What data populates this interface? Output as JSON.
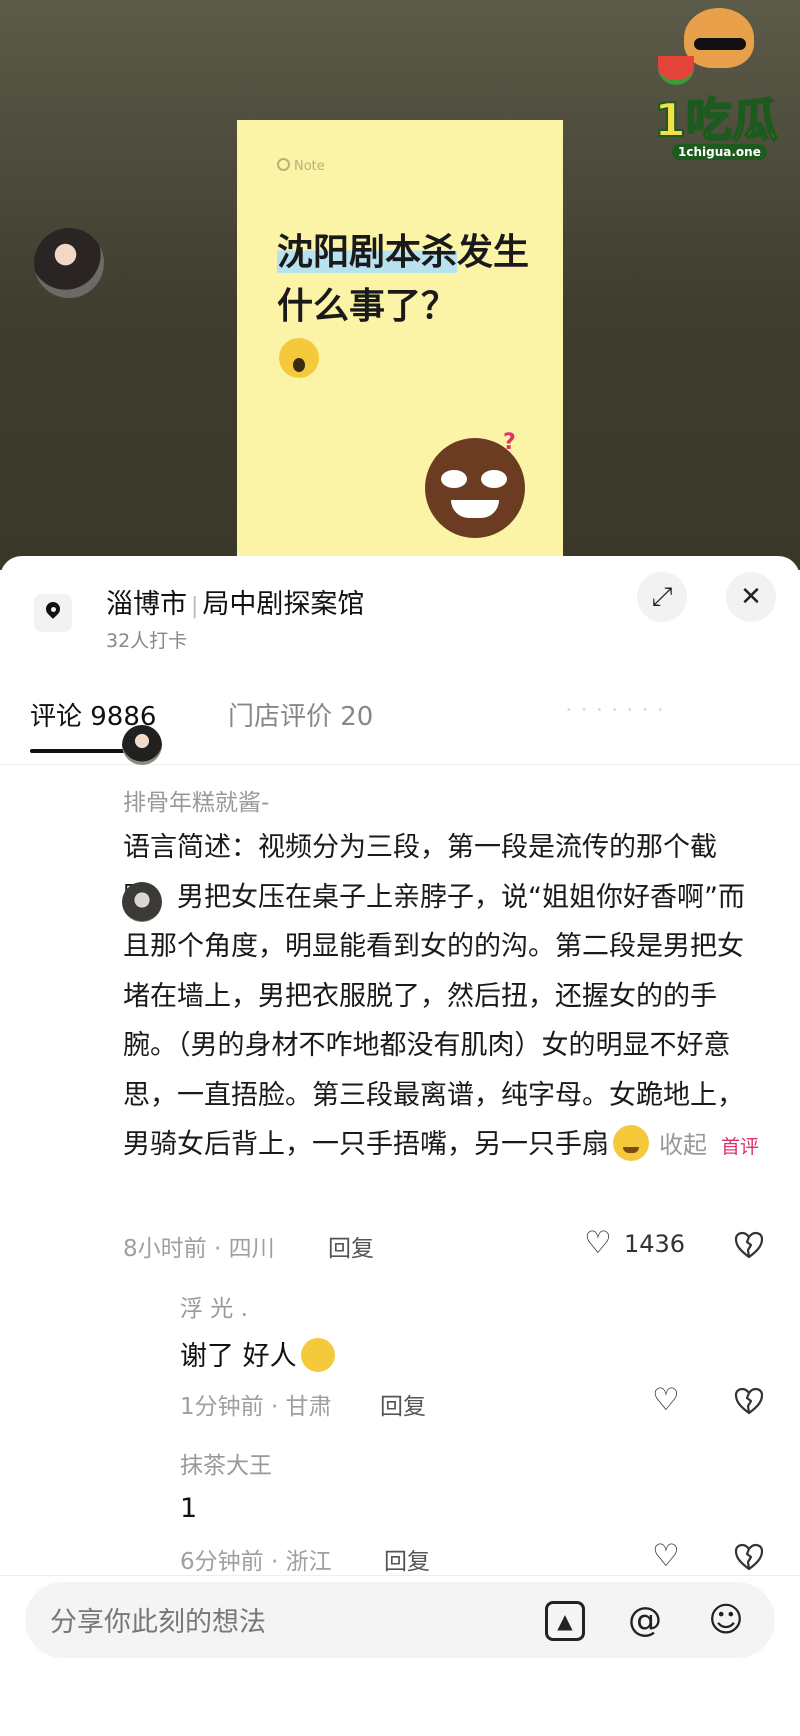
{
  "card": {
    "brand": "Note",
    "title_highlight": "沈阳剧本杀",
    "title_rest": "发生什么事了？"
  },
  "watermark": {
    "brand": "1吃瓜",
    "site": "1chigua.one"
  },
  "location": {
    "city": "淄博市",
    "name": "局中剧探案馆",
    "checkins": "32人打卡"
  },
  "icons": {
    "location": "map-pin-icon",
    "expand": "expand-icon",
    "close": "close-icon",
    "like": "heart-icon",
    "dislike": "broken-heart-icon",
    "image": "image-icon",
    "mention": "at-icon",
    "emoji": "smiley-icon"
  },
  "tabs": [
    {
      "label": "评论 9886",
      "active": true
    },
    {
      "label": "门店评价 20",
      "active": false
    }
  ],
  "comments": {
    "main": {
      "username": "排骨年糕就酱-",
      "text": "语言简述：视频分为三段，第一段是流传的那个截图，男把女压在桌子上亲脖子，说“姐姐你好香啊”而且那个角度，明显能看到女的的沟。第二段是男把女堵在墙上，男把衣服脱了，然后扭，还握女的的手腕。（男的身材不咋地都没有肌肉）女的明显不好意思，一直捂脸。第三段最离谱，纯字母。女跪地上，男骑女后背上，一只手捂嘴，另一只手扇",
      "collapse": "收起",
      "badge": "首评",
      "time_location": "8小时前 · 四川",
      "reply": "回复",
      "likes": "1436"
    },
    "replies": [
      {
        "username": "浮 光 .",
        "text": "谢了 好人",
        "time_location": "1分钟前 · 甘肃",
        "reply": "回复"
      },
      {
        "username": "抹茶大王",
        "text": "1",
        "time_location": "6分钟前 · 浙江",
        "reply": "回复"
      }
    ]
  },
  "input": {
    "placeholder": "分享你此刻的想法"
  }
}
